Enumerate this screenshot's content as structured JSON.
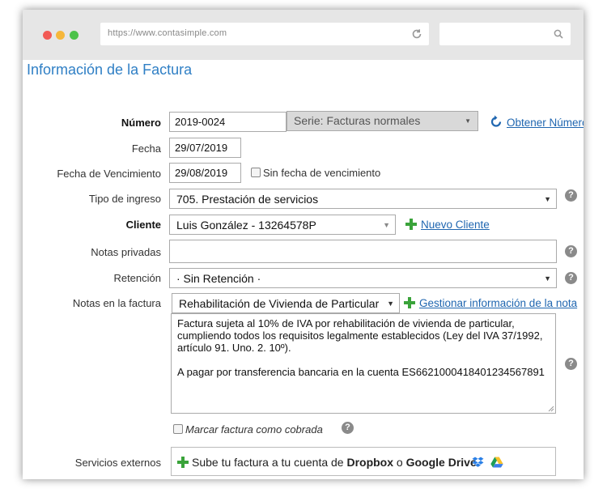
{
  "browser": {
    "url": "https://www.contasimple.com",
    "reload_icon": "reload-icon",
    "search_icon": "search-icon"
  },
  "page": {
    "title": "Información de la Factura"
  },
  "form": {
    "numero": {
      "label": "Número",
      "value": "2019-0024",
      "serie": "Serie: Facturas normales",
      "obtener_link": "Obtener Número"
    },
    "fecha": {
      "label": "Fecha",
      "value": "29/07/2019"
    },
    "vencimiento": {
      "label": "Fecha de Vencimiento",
      "value": "29/08/2019",
      "sin_fecha_label": "Sin fecha de vencimiento"
    },
    "tipo_ingreso": {
      "label": "Tipo de ingreso",
      "value": "705. Prestación de servicios"
    },
    "cliente": {
      "label": "Cliente",
      "value": "Luis González - 13264578P",
      "nuevo_link": "Nuevo Cliente"
    },
    "notas_privadas": {
      "label": "Notas privadas",
      "value": ""
    },
    "retencion": {
      "label": "Retención",
      "value": "· Sin Retención ·"
    },
    "notas_factura": {
      "label": "Notas en la factura",
      "selected": "Rehabilitación de Vivienda de Particular",
      "gestionar_link": "Gestionar información de la nota",
      "text_line1": "Factura sujeta al 10% de IVA por rehabilitación de vivienda de particular,",
      "text_line2": "cumpliendo todos los requisitos legalmente establecidos (Ley del IVA 37/1992,",
      "text_line3": "artículo 91. Uno. 2. 10º).",
      "text_line4": "A pagar por transferencia bancaria en la cuenta ES6621000418401234567891"
    },
    "marcar_cobrada_label": "Marcar factura como cobrada",
    "servicios_externos": {
      "label": "Servicios externos",
      "text_prefix": "Sube tu factura a tu cuenta de",
      "dropbox": "Dropbox",
      "connector": "o",
      "gdrive": "Google Drive"
    }
  },
  "help_glyph": "?",
  "colors": {
    "accent": "#2f7fc5",
    "link": "#1f66b0",
    "plus_green": "#3aa33a"
  }
}
